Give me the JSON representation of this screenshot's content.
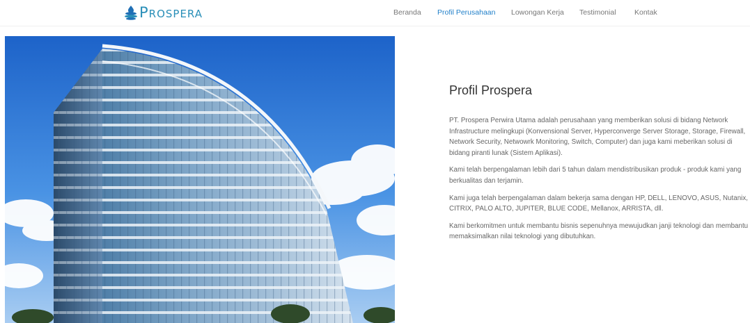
{
  "header": {
    "logo_text": "Prospera",
    "nav": [
      {
        "label": "Beranda",
        "active": false
      },
      {
        "label": "Profil Perusahaan",
        "active": true
      },
      {
        "label": "Lowongan Kerja",
        "active": false
      },
      {
        "label": "Testimonial",
        "active": false
      },
      {
        "label": "Kontak",
        "active": false
      }
    ]
  },
  "profile": {
    "title": "Profil Prospera",
    "paragraphs": [
      "PT. Prospera Perwira Utama adalah perusahaan yang memberikan solusi di bidang Network Infrastructure melingkupi (Konvensional Server, Hyperconverge Server Storage, Storage, Firewall, Network Security, Netwowrk Monitoring, Switch, Computer) dan juga kami meberikan solusi di bidang piranti lunak (Sistem Aplikasi).",
      "Kami telah berpengalaman lebih dari 5 tahun dalam mendistribusikan produk - produk kami yang berkualitas dan terjamin.",
      "Kami juga telah berpengalaman dalam bekerja sama dengan HP, DELL, LENOVO, ASUS, Nutanix, CITRIX, PALO ALTO, JUPITER, BLUE CODE, Mellanox, ARRISTA, dll.",
      "Kami berkomitmen untuk membantu bisnis sepenuhnya mewujudkan janji teknologi dan membantu memaksimalkan nilai teknologi yang dibutuhkan."
    ]
  },
  "colors": {
    "brand": "#2a8fb8",
    "nav_active": "#1f7fc9",
    "sky": "#2f78d8"
  },
  "icons": {
    "logo": "water-drop-stack-icon"
  }
}
